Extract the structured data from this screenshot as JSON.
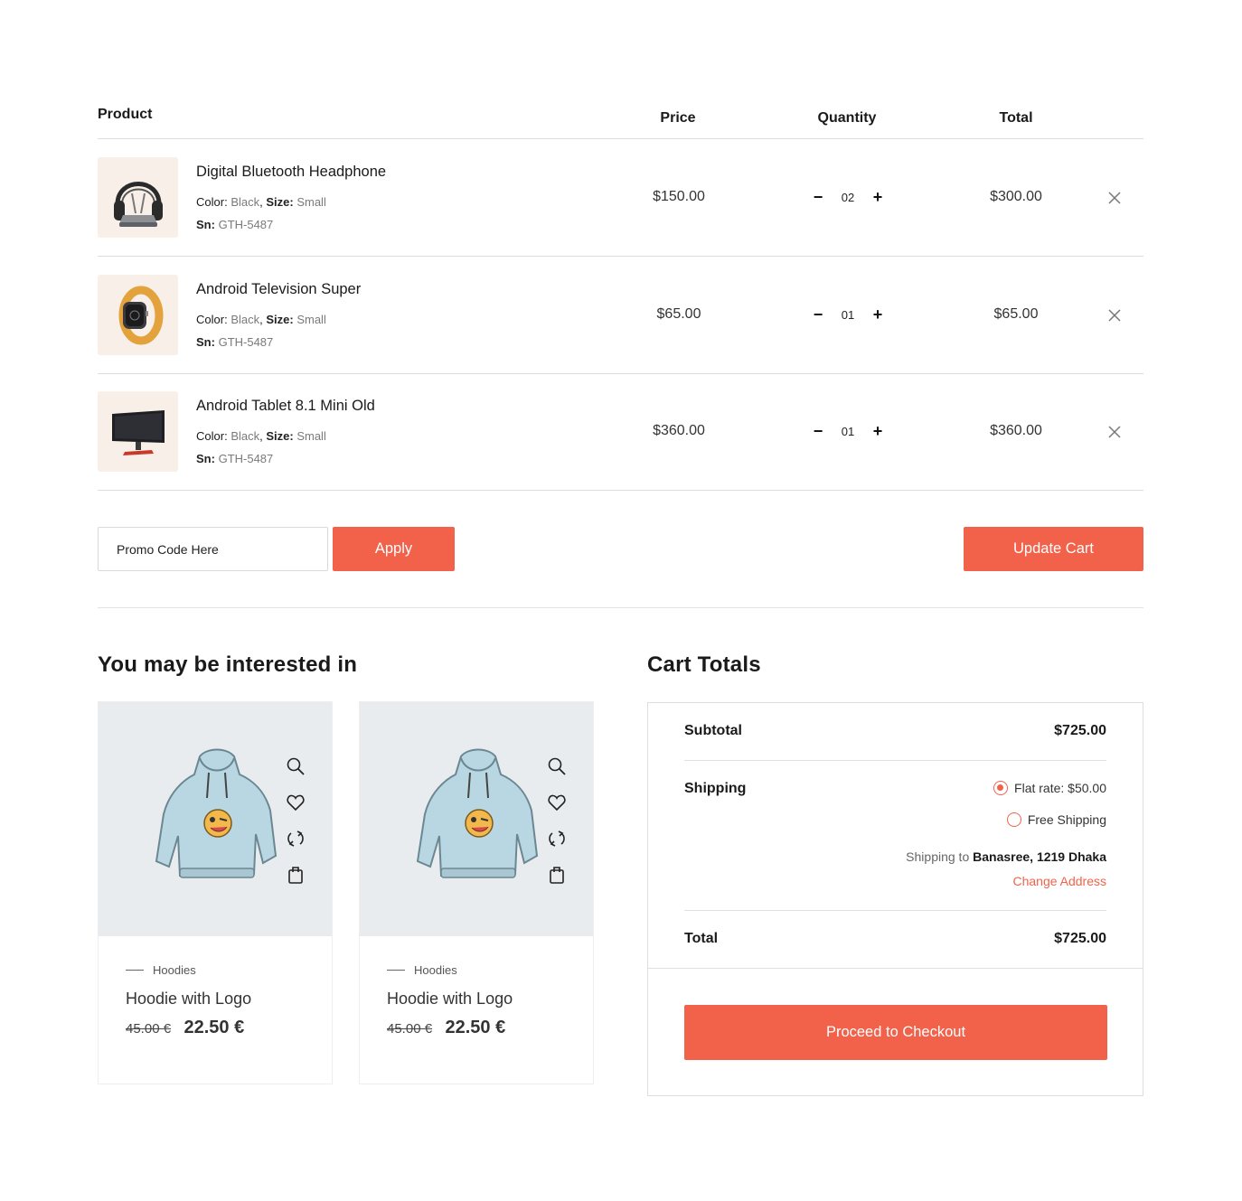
{
  "table": {
    "headers": {
      "product": "Product",
      "price": "Price",
      "quantity": "Quantity",
      "total": "Total"
    },
    "items": [
      {
        "name": "Digital Bluetooth Headphone",
        "color_label": "Color:",
        "color": "Black",
        "size_label": "Size:",
        "size": "Small",
        "sn_label": "Sn:",
        "sn": "GTH-5487",
        "price": "$150.00",
        "qty": "02",
        "total": "$300.00",
        "image_icon": "headphone-icon"
      },
      {
        "name": "Android Television Super",
        "color_label": "Color:",
        "color": "Black",
        "size_label": "Size:",
        "size": "Small",
        "sn_label": "Sn:",
        "sn": "GTH-5487",
        "price": "$65.00",
        "qty": "01",
        "total": "$65.00",
        "image_icon": "smartwatch-icon"
      },
      {
        "name": "Android Tablet 8.1 Mini Old",
        "color_label": "Color:",
        "color": "Black",
        "size_label": "Size:",
        "size": "Small",
        "sn_label": "Sn:",
        "sn": "GTH-5487",
        "price": "$360.00",
        "qty": "01",
        "total": "$360.00",
        "image_icon": "monitor-icon"
      }
    ],
    "qty_minus": "−",
    "qty_plus": "+"
  },
  "promo": {
    "placeholder": "Promo Code Here",
    "apply_label": "Apply"
  },
  "update_cart_label": "Update Cart",
  "interested": {
    "title": "You may be interested in",
    "products": [
      {
        "category": "Hoodies",
        "name": "Hoodie with Logo",
        "old_price": "45.00 €",
        "price": "22.50 €"
      },
      {
        "category": "Hoodies",
        "name": "Hoodie with Logo",
        "old_price": "45.00 €",
        "price": "22.50 €"
      }
    ]
  },
  "totals": {
    "title": "Cart Totals",
    "subtotal_label": "Subtotal",
    "subtotal": "$725.00",
    "shipping_label": "Shipping",
    "shipping_options": [
      {
        "label": "Flat rate: $50.00",
        "selected": true
      },
      {
        "label": "Free Shipping",
        "selected": false
      }
    ],
    "shipping_to_prefix": "Shipping to",
    "shipping_address": "Banasree, 1219 Dhaka",
    "change_address": "Change Address",
    "total_label": "Total",
    "total": "$725.00",
    "checkout_label": "Proceed to Checkout"
  },
  "colors": {
    "accent": "#f2624a",
    "thumb_bg": "#f7efe8",
    "card_bg": "#e8ecef",
    "border": "#dcdcdc"
  }
}
